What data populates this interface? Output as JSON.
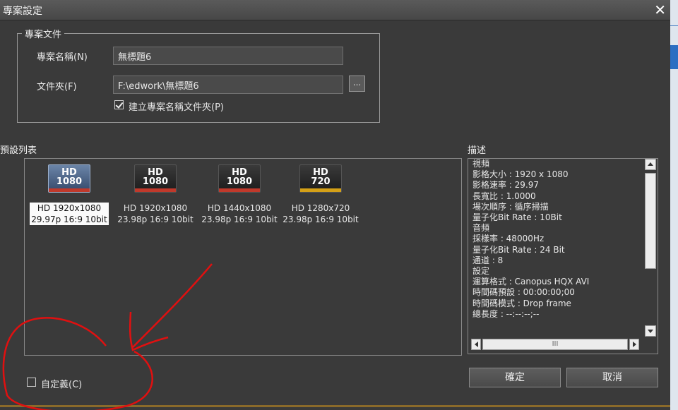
{
  "window": {
    "title": "專案設定"
  },
  "project": {
    "group_label": "專案文件",
    "name_label": "專案名稱(N)",
    "name_value": "無標題6",
    "folder_label": "文件夾(F)",
    "folder_value": "F:\\edwork\\無標題6",
    "browse_label": "...",
    "create_folder_label": "建立專案名稱文件夾(P)",
    "create_folder_checked": true
  },
  "presets": {
    "label": "預設列表",
    "items": [
      {
        "hd": "HD",
        "res": "1080",
        "line1": "HD 1920x1080",
        "line2": "29.97p 16:9 10bit",
        "selected": true,
        "bar_color": "#c0392b"
      },
      {
        "hd": "HD",
        "res": "1080",
        "line1": "HD 1920x1080",
        "line2": "23.98p 16:9 10bit",
        "selected": false,
        "bar_color": "#c0392b"
      },
      {
        "hd": "HD",
        "res": "1080",
        "line1": "HD 1440x1080",
        "line2": "23.98p 16:9 10bit",
        "selected": false,
        "bar_color": "#c0392b"
      },
      {
        "hd": "HD",
        "res": "720",
        "line1": "HD 1280x720",
        "line2": "23.98p 16:9 10bit",
        "selected": false,
        "bar_color": "#d4a017"
      }
    ]
  },
  "description": {
    "label": "描述",
    "lines": [
      "視頻",
      "影格大小 : 1920 x 1080",
      "影格速率 : 29.97",
      "長寬比 : 1.0000",
      "場次順序 : 循序掃描",
      "量子化Bit Rate : 10Bit",
      "音頻",
      "採樣率 : 48000Hz",
      "量子化Bit Rate : 24 Bit",
      "通道 : 8",
      "設定",
      "運算格式 : Canopus HQX AVI",
      "時間碼預設 : 00:00:00;00",
      "時間碼模式 : Drop frame",
      "總長度 : --:--:--;--"
    ],
    "hscroll_grip": "III"
  },
  "custom": {
    "label": "自定義(C)",
    "checked": false
  },
  "buttons": {
    "ok": "確定",
    "cancel": "取消"
  }
}
